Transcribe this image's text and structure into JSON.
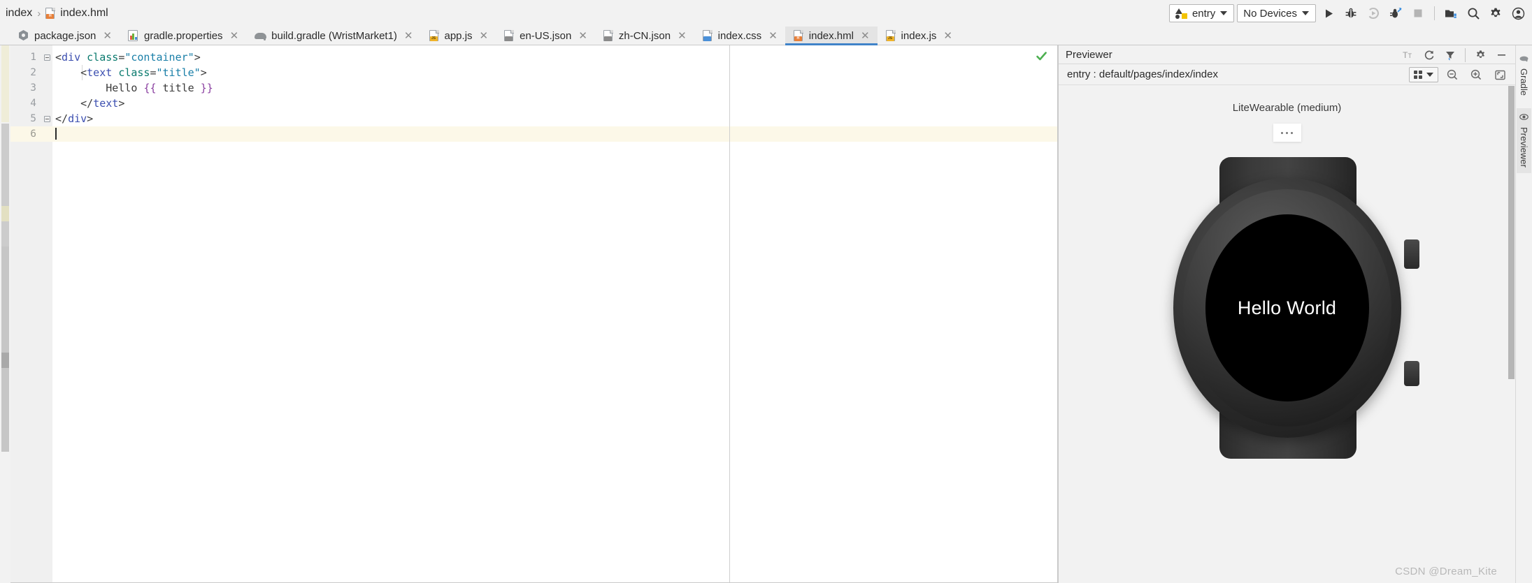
{
  "breadcrumb": {
    "root": "index",
    "separator": "›",
    "file": "index.hml",
    "file_icon": "hml-file-icon"
  },
  "run_toolbar": {
    "config_label": "entry",
    "device_label": "No Devices",
    "buttons": [
      {
        "name": "run-button",
        "label": "Run"
      },
      {
        "name": "debug-button",
        "label": "Debug"
      },
      {
        "name": "run-coverage-button",
        "label": "Run with Coverage"
      },
      {
        "name": "profile-button",
        "label": "Profile"
      },
      {
        "name": "stop-button",
        "label": "Stop"
      },
      {
        "name": "project-structure-button",
        "label": "Project Structure"
      },
      {
        "name": "search-everywhere-button",
        "label": "Search Everywhere"
      },
      {
        "name": "settings-button",
        "label": "Settings"
      },
      {
        "name": "account-button",
        "label": "Account"
      }
    ]
  },
  "tabs": [
    {
      "label": "package.json",
      "icon": "json-package-icon",
      "active": false
    },
    {
      "label": "gradle.properties",
      "icon": "properties-icon",
      "active": false
    },
    {
      "label": "build.gradle (WristMarket1)",
      "icon": "gradle-icon",
      "active": false
    },
    {
      "label": "app.js",
      "icon": "js-file-icon",
      "active": false
    },
    {
      "label": "en-US.json",
      "icon": "json-file-icon",
      "active": false
    },
    {
      "label": "zh-CN.json",
      "icon": "json-file-icon",
      "active": false
    },
    {
      "label": "index.css",
      "icon": "css-file-icon",
      "active": false
    },
    {
      "label": "index.hml",
      "icon": "hml-file-icon",
      "active": true
    },
    {
      "label": "index.js",
      "icon": "js-file-icon",
      "active": false
    }
  ],
  "tab_close_glyph": "✕",
  "editor": {
    "line_numbers": [
      "1",
      "2",
      "3",
      "4",
      "5",
      "6"
    ],
    "current_line": 6,
    "inspection_status": "ok",
    "lines": [
      {
        "n": 1,
        "tokens": [
          {
            "t": "<",
            "c": "tok-punct"
          },
          {
            "t": "div",
            "c": "tok-tag"
          },
          {
            "t": " ",
            "c": "tok-text"
          },
          {
            "t": "class",
            "c": "tok-attr"
          },
          {
            "t": "=",
            "c": "tok-eq"
          },
          {
            "t": "\"container\"",
            "c": "tok-str"
          },
          {
            "t": ">",
            "c": "tok-punct"
          }
        ]
      },
      {
        "n": 2,
        "tokens": [
          {
            "t": "    ",
            "c": "tok-text"
          },
          {
            "t": "<",
            "c": "tok-punct"
          },
          {
            "t": "text",
            "c": "tok-tag"
          },
          {
            "t": " ",
            "c": "tok-text"
          },
          {
            "t": "class",
            "c": "tok-attr"
          },
          {
            "t": "=",
            "c": "tok-eq"
          },
          {
            "t": "\"title\"",
            "c": "tok-str"
          },
          {
            "t": ">",
            "c": "tok-punct"
          }
        ]
      },
      {
        "n": 3,
        "tokens": [
          {
            "t": "        ",
            "c": "tok-text"
          },
          {
            "t": "Hello ",
            "c": "tok-text"
          },
          {
            "t": "{{",
            "c": "tok-mus"
          },
          {
            "t": " title ",
            "c": "tok-var"
          },
          {
            "t": "}}",
            "c": "tok-mus"
          }
        ]
      },
      {
        "n": 4,
        "tokens": [
          {
            "t": "    ",
            "c": "tok-text"
          },
          {
            "t": "</",
            "c": "tok-punct"
          },
          {
            "t": "text",
            "c": "tok-tag"
          },
          {
            "t": ">",
            "c": "tok-punct"
          }
        ]
      },
      {
        "n": 5,
        "tokens": [
          {
            "t": "</",
            "c": "tok-punct"
          },
          {
            "t": "div",
            "c": "tok-tag"
          },
          {
            "t": ">",
            "c": "tok-punct"
          }
        ]
      },
      {
        "n": 6,
        "tokens": []
      }
    ]
  },
  "previewer": {
    "title": "Previewer",
    "head_actions": [
      {
        "name": "font-size-icon",
        "label": "Tt"
      },
      {
        "name": "refresh-icon",
        "label": "Refresh"
      },
      {
        "name": "filter-icon",
        "label": "Filter"
      },
      {
        "name": "settings-gear-icon",
        "label": "Settings"
      },
      {
        "name": "minimize-icon",
        "label": "Hide"
      }
    ],
    "path": "entry : default/pages/index/index",
    "path_actions": [
      {
        "name": "layout-grid-dropdown",
        "label": "Layout"
      },
      {
        "name": "zoom-out-icon",
        "label": "Zoom Out"
      },
      {
        "name": "zoom-in-icon",
        "label": "Zoom In"
      },
      {
        "name": "fit-to-window-icon",
        "label": "Fit"
      }
    ],
    "device_label": "LiteWearable (medium)",
    "more_button_label": "…",
    "screen_text": "Hello World"
  },
  "right_rail": [
    {
      "label": "Gradle",
      "icon": "gradle-icon",
      "active": false
    },
    {
      "label": "Previewer",
      "icon": "eye-icon",
      "active": true
    }
  ],
  "watermark": "CSDN @Dream_Kite",
  "colors": {
    "accent": "#4083c9",
    "panel_bg": "#f2f2f2",
    "editor_bg": "#ffffff",
    "current_line": "#fcf8e8",
    "tag": "#3c4fb0",
    "attr": "#0a7a6e",
    "string": "#1a7fa8",
    "mustache": "#8a3fa0",
    "ok_check": "#4caf50",
    "entry_yellow": "#f3c300",
    "screen_bg": "#000000",
    "screen_text": "#ffffff"
  }
}
